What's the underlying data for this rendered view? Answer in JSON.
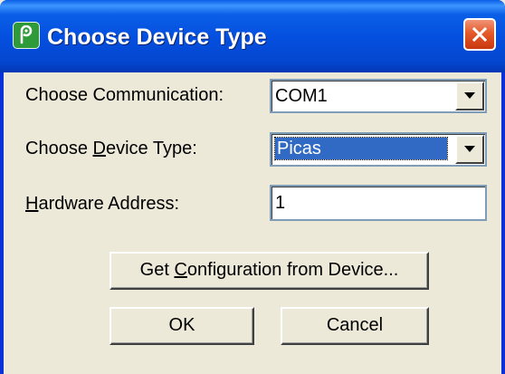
{
  "window": {
    "title": "Choose Device Type",
    "app_icon": "app-logo-icon",
    "close_icon": "close-icon"
  },
  "form": {
    "communication": {
      "label_pre": "Choose Communication:",
      "value": "COM1"
    },
    "device_type": {
      "label_pre": "Choose ",
      "label_mnemonic": "D",
      "label_post": "evice Type:",
      "value": "Picas"
    },
    "hardware_address": {
      "label_mnemonic": "H",
      "label_post": "ardware Address:",
      "value": "1"
    }
  },
  "buttons": {
    "get_config": {
      "pre": "Get ",
      "mnemonic": "C",
      "post": "onfiguration from Device..."
    },
    "ok": "OK",
    "cancel": "Cancel"
  },
  "colors": {
    "titlebar": "#0550E0",
    "client_bg": "#ECE9D8",
    "selection": "#316AC5",
    "close_button": "#E45A2A"
  }
}
